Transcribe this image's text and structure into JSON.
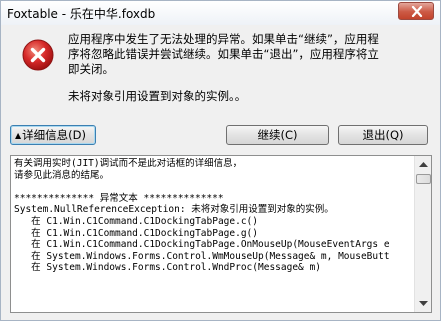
{
  "window": {
    "title": "Foxtable - 乐在中华.foxdb"
  },
  "icons": {
    "error": "error-x-icon",
    "close": "close-icon"
  },
  "message": {
    "main": "应用程序中发生了无法处理的异常。如果单击“继续”，应用程\n序将忽略此错误并尝试继续。如果单击“退出”，应用程序将立\n即关闭。",
    "detail": "未将对象引用设置到对象的实例。。"
  },
  "buttons": {
    "details": "详细信息(D)",
    "continue": "继续(C)",
    "quit": "退出(Q)"
  },
  "details": {
    "text": "有关调用实时(JIT)调试而不是此对话框的详细信息，\n请参见此消息的结尾。\n\n************** 异常文本 **************\nSystem.NullReferenceException: 未将对象引用设置到对象的实例。\n   在 C1.Win.C1Command.C1DockingTabPage.c()\n   在 C1.Win.C1Command.C1DockingTabPage.g()\n   在 C1.Win.C1Command.C1DockingTabPage.OnMouseUp(MouseEventArgs e\n   在 System.Windows.Forms.Control.WmMouseUp(Message& m, MouseButt\n   在 System.Windows.Forms.Control.WndProc(Message& m)"
  },
  "colors": {
    "error_icon": "#d72a2a",
    "close_button": "#c8452f",
    "focus_border": "#3c7fb1"
  }
}
